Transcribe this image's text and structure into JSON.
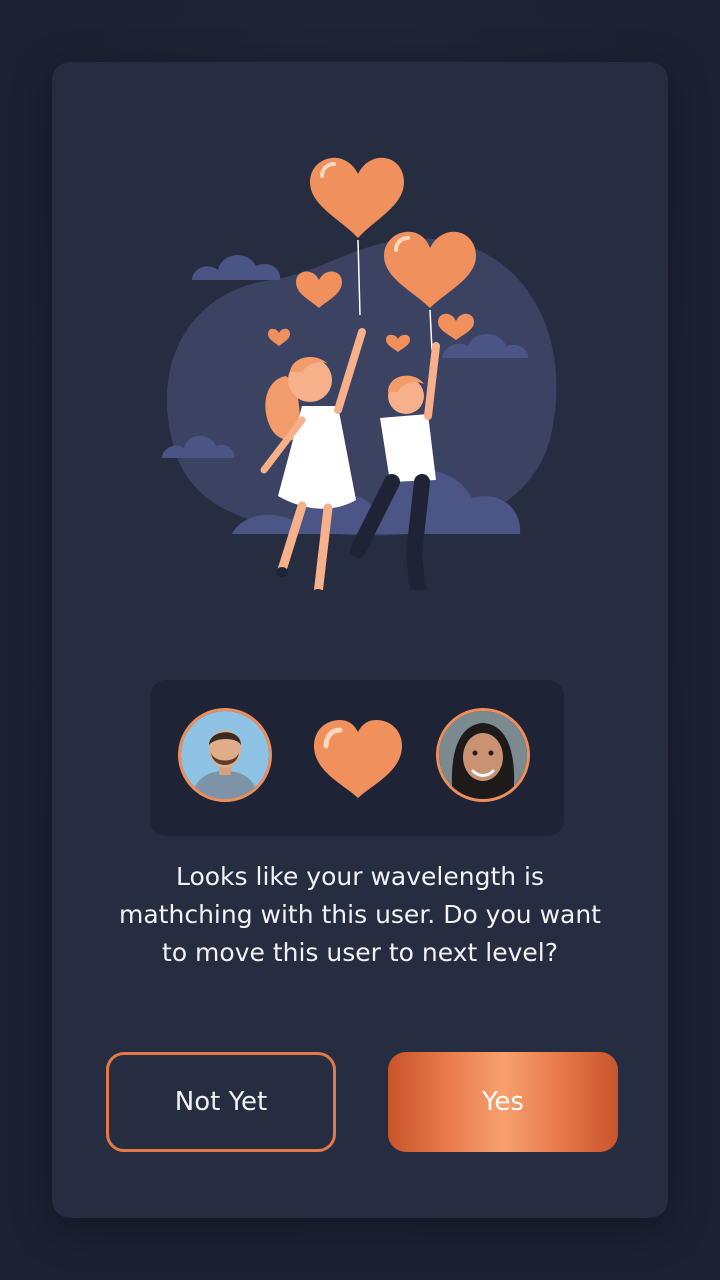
{
  "dialog": {
    "message_lines": [
      "Looks like your wavelength is",
      "mathching with this user. Do you want",
      "to move this user to next level?"
    ],
    "buttons": {
      "decline_label": "Not Yet",
      "accept_label": "Yes"
    }
  },
  "match": {
    "left_avatar_icon": "user-avatar-man",
    "right_avatar_icon": "user-avatar-woman",
    "center_icon": "heart-icon"
  },
  "colors": {
    "accent": "#ef8e5a",
    "card": "#272d40",
    "background": "#1c2233"
  }
}
